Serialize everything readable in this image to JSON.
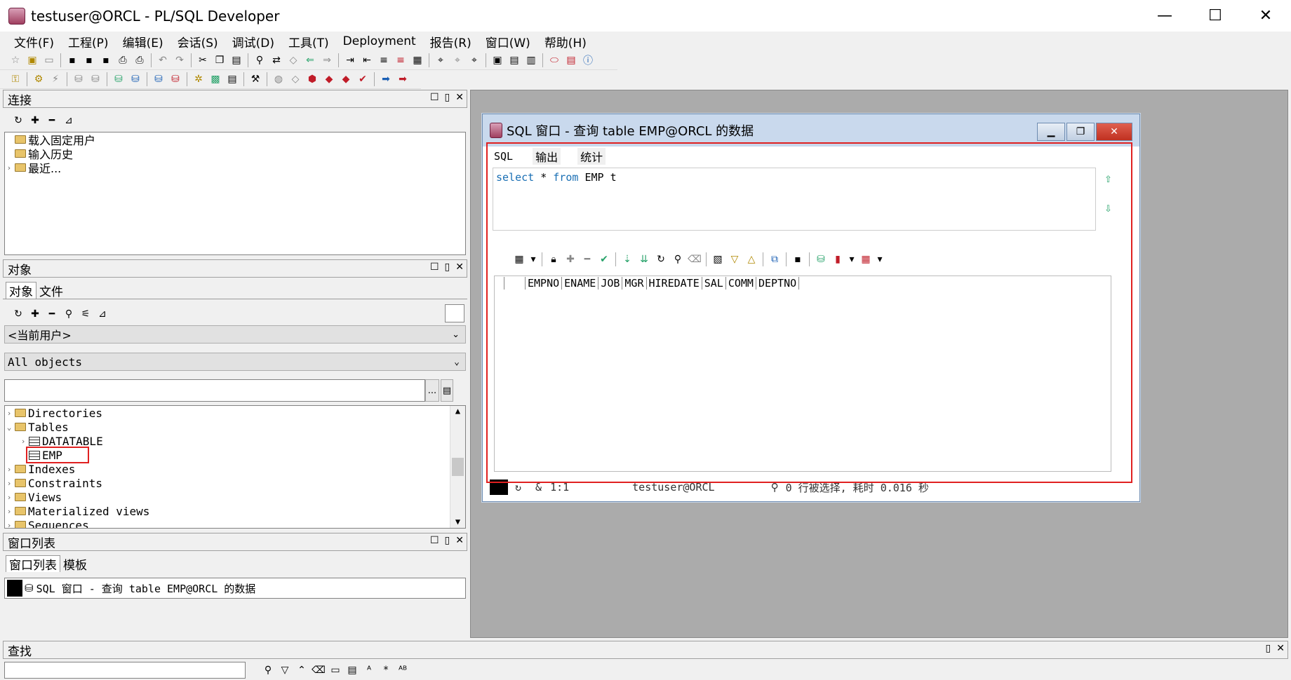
{
  "window": {
    "title": "testuser@ORCL - PL/SQL Developer",
    "minimize": "—",
    "maximize": "☐",
    "close": "✕"
  },
  "menu": [
    "文件(F)",
    "工程(P)",
    "编辑(E)",
    "会话(S)",
    "调试(D)",
    "工具(T)",
    "Deployment",
    "报告(R)",
    "窗口(W)",
    "帮助(H)"
  ],
  "connection_panel": {
    "title": "连接",
    "items": [
      "载入固定用户",
      "输入历史",
      "最近..."
    ]
  },
  "objects_panel": {
    "title": "对象",
    "tabs": [
      "对象",
      "文件"
    ],
    "user_select": "<当前用户>",
    "filter_select": "All objects",
    "search_value": "",
    "browse_button": "...",
    "tree": [
      {
        "label": "Directories",
        "type": "folder",
        "indent": 0
      },
      {
        "label": "Tables",
        "type": "folder",
        "indent": 0,
        "expanded": true
      },
      {
        "label": "DATATABLE",
        "type": "table",
        "indent": 1
      },
      {
        "label": "EMP",
        "type": "table",
        "indent": 1,
        "highlighted": true
      },
      {
        "label": "Indexes",
        "type": "folder",
        "indent": 0
      },
      {
        "label": "Constraints",
        "type": "folder",
        "indent": 0
      },
      {
        "label": "Views",
        "type": "folder",
        "indent": 0
      },
      {
        "label": "Materialized views",
        "type": "folder",
        "indent": 0
      },
      {
        "label": "Sequences",
        "type": "folder",
        "indent": 0
      }
    ]
  },
  "window_list_panel": {
    "title": "窗口列表",
    "tabs": [
      "窗口列表",
      "模板"
    ],
    "items": [
      "SQL 窗口 - 查询 table EMP@ORCL 的数据"
    ]
  },
  "find_panel": {
    "title": "查找",
    "search_value": ""
  },
  "sql_window": {
    "title": "SQL 窗口 - 查询 table EMP@ORCL 的数据",
    "tabs": [
      "SQL",
      "输出",
      "统计"
    ],
    "sql_text": [
      "select",
      "*",
      "from",
      "EMP",
      "t"
    ],
    "columns": [
      "EMPNO",
      "ENAME",
      "JOB",
      "MGR",
      "HIREDATE",
      "SAL",
      "COMM",
      "DEPTNO"
    ],
    "status": {
      "position": "1:1",
      "connection": "testuser@ORCL",
      "message": "0 行被选择, 耗时 0.016 秒"
    }
  },
  "colors": {
    "highlight": "#e02020",
    "keyword": "#1a6fb4",
    "mdi_bg": "#ababab"
  }
}
